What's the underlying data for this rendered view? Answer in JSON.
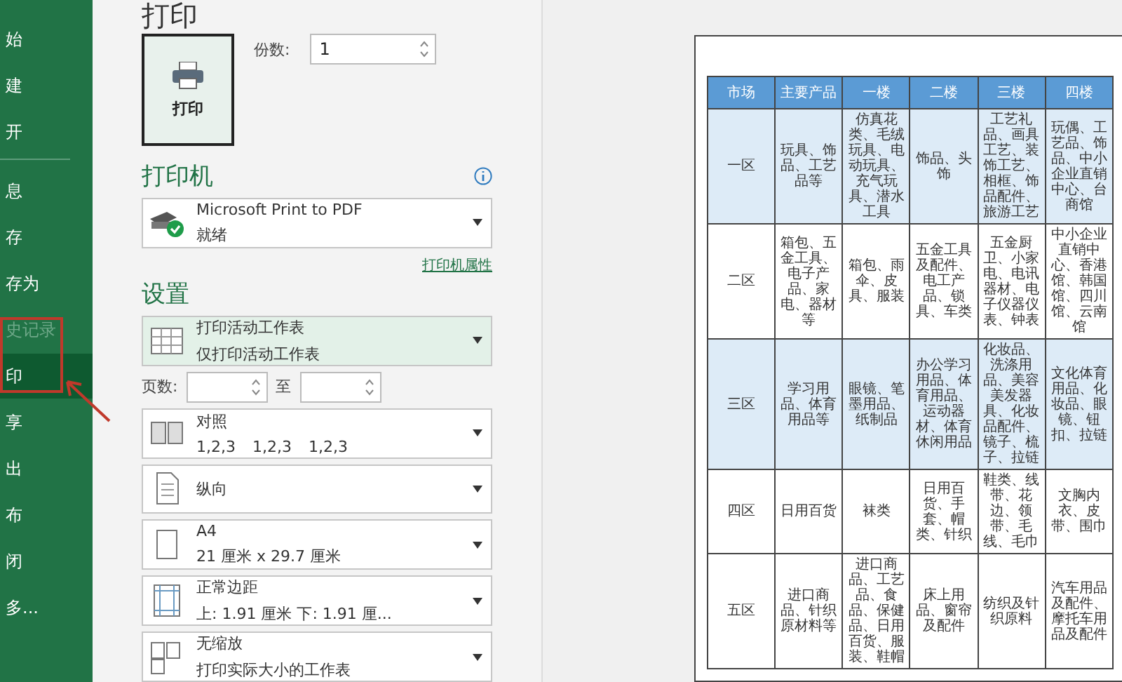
{
  "sidebar": {
    "groups": [
      [
        {
          "label": "始",
          "selected": false,
          "disabled": false
        },
        {
          "label": "建",
          "selected": false,
          "disabled": false
        },
        {
          "label": "开",
          "selected": false,
          "disabled": false
        }
      ],
      [
        {
          "label": "息",
          "selected": false,
          "disabled": false
        },
        {
          "label": "存",
          "selected": false,
          "disabled": false
        },
        {
          "label": "存为",
          "selected": false,
          "disabled": false
        },
        {
          "label": "史记录",
          "selected": false,
          "disabled": true
        },
        {
          "label": "印",
          "selected": true,
          "disabled": false
        },
        {
          "label": "享",
          "selected": false,
          "disabled": false
        },
        {
          "label": "出",
          "selected": false,
          "disabled": false
        },
        {
          "label": "布",
          "selected": false,
          "disabled": false
        },
        {
          "label": "闭",
          "selected": false,
          "disabled": false
        },
        {
          "label": "多...",
          "selected": false,
          "disabled": false
        }
      ]
    ]
  },
  "title": "打印",
  "print_button": "打印",
  "copies": {
    "label": "份数:",
    "value": "1"
  },
  "printer": {
    "heading": "打印机",
    "name": "Microsoft Print to PDF",
    "status": "就绪",
    "properties_link": "打印机属性"
  },
  "settings": {
    "heading": "设置",
    "scope": {
      "kind": "sheet",
      "line1": "打印活动工作表",
      "line2": "仅打印活动工作表"
    },
    "pages": {
      "label": "页数:",
      "to": "至"
    },
    "options": [
      {
        "kind": "collate",
        "line1": "对照",
        "line2": [
          "1,2,3",
          "1,2,3",
          "1,2,3"
        ]
      },
      {
        "kind": "portrait",
        "line1": "纵向"
      },
      {
        "kind": "paper",
        "line1": "A4",
        "line2": [
          "21 厘米 x 29.7 厘米"
        ]
      },
      {
        "kind": "margins",
        "line1": "正常边距",
        "line2": [
          "上: 1.91 厘米 下: 1.91 厘..."
        ]
      },
      {
        "kind": "scaling",
        "line1": "无缩放",
        "line2": [
          "打印实际大小的工作表"
        ]
      }
    ]
  },
  "preview": {
    "table": {
      "columns": [
        "市场",
        "主要产品",
        "一楼",
        "二楼",
        "三楼",
        "四楼"
      ],
      "rows": [
        [
          "一区",
          "玩具、饰品、工艺品等",
          "仿真花类、毛绒玩具、电动玩具、充气玩具、潜水工具",
          "饰品、头饰",
          "工艺礼品、画具工艺、装饰工艺、相框、饰品配件、旅游工艺",
          "玩偶、工艺品、饰品、中小企业直销中心、台商馆"
        ],
        [
          "二区",
          "箱包、五金工具、电子产品、家电、器材等",
          "箱包、雨伞、皮具、服装",
          "五金工具及配件、电工产品、锁具、车类",
          "五金厨卫、小家电、电讯器材、电子仪器仪表、钟表",
          "中小企业直销中心、香港馆、韩国馆、四川馆、云南馆"
        ],
        [
          "三区",
          "学习用品、体育用品等",
          "眼镜、笔墨用品、纸制品",
          "办公学习用品、体育用品、运动器材、体育休闲用品",
          "化妆品、洗涤用品、美容美发器具、化妆品配件、镜子、梳子、拉链",
          "文化体育用品、化妆品、眼镜、钮扣、拉链"
        ],
        [
          "四区",
          "日用百货",
          "袜类",
          "日用百货、手套、帽类、针织",
          "鞋类、线带、花边、领带、毛线、毛巾",
          "文胸内衣、皮带、围巾"
        ],
        [
          "五区",
          "进口商品、针织原材料等",
          "进口商品、工艺品、食品、保健品、日用百货、服装、鞋帽",
          "床上用品、窗帘及配件",
          "纺织及针织原料",
          "汽车用品及配件、摩托车用品及配件"
        ]
      ]
    }
  }
}
